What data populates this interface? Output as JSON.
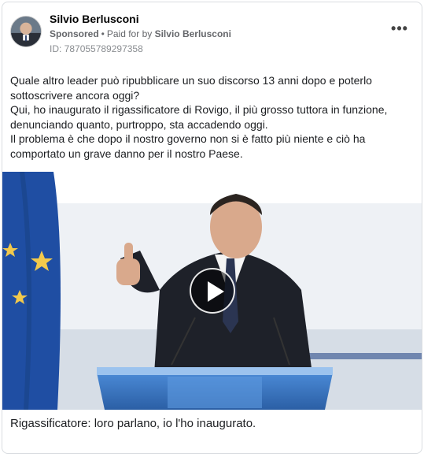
{
  "post": {
    "page_name": "Silvio Berlusconi",
    "sponsored_label": "Sponsored",
    "separator": "•",
    "paid_for_prefix": "Paid for by",
    "paid_for_name": "Silvio Berlusconi",
    "ad_id": "ID: 787055789297358",
    "more_icon": "more-horizontal-icon",
    "more_label": "•••",
    "body_lines": [
      "Quale altro leader può ripubblicare un suo discorso 13 anni dopo e poterlo sottoscrivere ancora oggi?",
      "Qui, ho inaugurato il rigassificatore di Rovigo, il più grosso tuttora in funzione, denunciando quanto, purtroppo, sta accadendo oggi.",
      "Il problema è che dopo il nostro governo non si è fatto più niente e ciò ha comportato un grave danno per il nostro Paese."
    ],
    "media": {
      "type": "video",
      "play_icon": "play-icon"
    },
    "caption": "Rigassificatore: loro parlano, io l'ho inaugurato."
  },
  "colors": {
    "text_primary": "#1c1e21",
    "text_secondary": "#65676b",
    "eu_flag_blue": "#1f4ea3",
    "eu_star_yellow": "#f2c94c",
    "podium_blue": "#3a78c2"
  }
}
